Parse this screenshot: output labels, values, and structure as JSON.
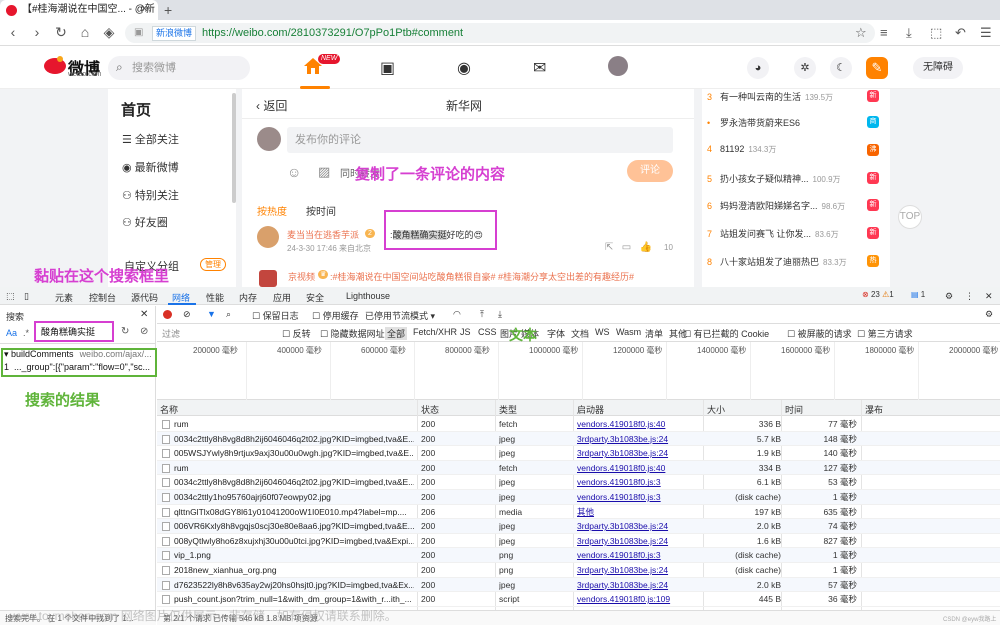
{
  "browser": {
    "tab_title": "【#桂海潮说在中国空... - @新",
    "new_tab": "+",
    "secure_label": "新浪微博",
    "url": "https://weibo.com/2810373291/O7pPo1Ptb#comment"
  },
  "weibo": {
    "logo_text": "微博",
    "logo_sub": "weibo.com",
    "search_placeholder": "搜索微博",
    "new_badge": "NEW",
    "access_button": "无障碍",
    "nav": {
      "home": "首页",
      "items": [
        "全部关注",
        "最新微博",
        "特别关注",
        "好友圈"
      ],
      "custom_group": "自定义分组",
      "manage": "管理"
    },
    "center": {
      "back": "返回",
      "title": "新华网",
      "comment_placeholder": "发布你的评论",
      "also_repost": "同时转发",
      "comment_button": "评论",
      "sort_hot": "按热度",
      "sort_time": "按时间",
      "comment": {
        "user": "麦当当在逃香芋派",
        "vip": "2",
        "text_highlight": "酸角糕确实挺",
        "text_rest": "好吃的😍",
        "meta": "24-3-30 17:46 来自北京",
        "likes": "10"
      },
      "repost_user": "京视频",
      "repost_text": ":#桂海潮说在中国空间站吃酸角糕很自豪# #桂海潮分享太空出差的有趣经历#"
    },
    "trending": [
      {
        "rank": "3",
        "title": "有一种叫云南的生活",
        "heat": "139.5万",
        "tag": "新",
        "color": "#ff3852"
      },
      {
        "rank": "•",
        "title": "罗永浩带货蔚来ES6",
        "heat": "",
        "tag": "商",
        "color": "#00b7ee"
      },
      {
        "rank": "4",
        "title": "81192",
        "heat": "134.3万",
        "tag": "沸",
        "color": "#f86400"
      },
      {
        "rank": "5",
        "title": "扔小孩女子疑似精神...",
        "heat": "100.9万",
        "tag": "新",
        "color": "#ff3852"
      },
      {
        "rank": "6",
        "title": "妈妈澄清欧阳娣娣名字...",
        "heat": "98.6万",
        "tag": "新",
        "color": "#ff3852"
      },
      {
        "rank": "7",
        "title": "站姐发问赛飞 让你发...",
        "heat": "83.6万",
        "tag": "新",
        "color": "#ff3852"
      },
      {
        "rank": "8",
        "title": "八十家站姐发了迪丽热巴",
        "heat": "83.3万",
        "tag": "热",
        "color": "#ff9406"
      }
    ],
    "totop": "TOP"
  },
  "annotations": {
    "copied": "复制了一条评论的内容",
    "paste_here": "黏贴在这个搜索框里",
    "text_label": "文本",
    "search_result": "搜索的结果"
  },
  "devtools": {
    "tabs": [
      "元素",
      "控制台",
      "源代码",
      "网络",
      "性能",
      "内存",
      "应用",
      "安全",
      "Lighthouse"
    ],
    "errors": "23",
    "warnings": "1",
    "messages": "1",
    "search_title": "搜索",
    "search_case": "Aa",
    "search_regex": ".*",
    "search_value": "酸角糕确实挺",
    "result_file": "buildComments",
    "result_url": "weibo.com/ajax/...",
    "result_line_no": "1",
    "result_line": "..._group\":[{\"param\":\"flow=0\",\"sc...",
    "search_status": "搜索完毕。 在 1 个文件中找到了 1...",
    "toolbar": {
      "preserve_log": "保留日志",
      "disable_cache": "停用缓存",
      "throttle": "已停用节流模式"
    },
    "filter": {
      "placeholder": "过滤",
      "invert": "反转",
      "hide_data": "隐藏数据网址",
      "types": [
        "全部",
        "Fetch/XHR",
        "JS",
        "CSS",
        "图片",
        "媒体",
        "字体",
        "文档",
        "WS",
        "Wasm",
        "清单",
        "其他"
      ],
      "blocked_cookies": "有已拦截的 Cookie",
      "blocked_requests": "被屏蔽的请求",
      "third_party": "第三方请求"
    },
    "timeline_ticks": [
      "200000 毫秒",
      "400000 毫秒",
      "600000 毫秒",
      "800000 毫秒",
      "1000000 毫秒",
      "1200000 毫秒",
      "1400000 毫秒",
      "1600000 毫秒",
      "1800000 毫秒",
      "2000000 毫秒"
    ],
    "columns": [
      "名称",
      "状态",
      "类型",
      "启动器",
      "大小",
      "时间",
      "瀑布"
    ],
    "rows": [
      {
        "name": "rum",
        "status": "200",
        "type": "fetch",
        "initiator": "vendors.419018f0.js:40",
        "size": "336 B",
        "time": "77 毫秒"
      },
      {
        "name": "0034c2ttly8h8vg8d8h2ij6046046q2t02.jpg?KID=imgbed,tva&E...",
        "status": "200",
        "type": "jpeg",
        "initiator": "3rdparty.3b1083be.js:24",
        "size": "5.7 kB",
        "time": "148 毫秒"
      },
      {
        "name": "005WSJYwly8h9rtjux9axj30u00u0wgh.jpg?KID=imgbed,tva&E...",
        "status": "200",
        "type": "jpeg",
        "initiator": "3rdparty.3b1083be.js:24",
        "size": "1.9 kB",
        "time": "140 毫秒"
      },
      {
        "name": "rum",
        "status": "200",
        "type": "fetch",
        "initiator": "vendors.419018f0.js:40",
        "size": "334 B",
        "time": "127 毫秒"
      },
      {
        "name": "0034c2ttly8h8vg8d8h2ij6046046q2t02.jpg?KID=imgbed,tva&E...",
        "status": "200",
        "type": "jpeg",
        "initiator": "vendors.419018f0.js:3",
        "size": "6.1 kB",
        "time": "53 毫秒"
      },
      {
        "name": "0034c2ttly1ho95760ajrj60f07eowpy02.jpg",
        "status": "200",
        "type": "jpeg",
        "initiator": "vendors.419018f0.js:3",
        "size": "(disk cache)",
        "time": "1 毫秒"
      },
      {
        "name": "qlttnGlTlx08dGY8l61y01041200oW1I0E010.mp4?label=mp....",
        "status": "206",
        "type": "media",
        "initiator": "其他",
        "size": "197 kB",
        "time": "635 毫秒"
      },
      {
        "name": "006VR6Kxly8h8vgqjs0scj30e80e8aa6.jpg?KID=imgbed,tva&E...",
        "status": "200",
        "type": "jpeg",
        "initiator": "3rdparty.3b1083be.js:24",
        "size": "2.0 kB",
        "time": "74 毫秒"
      },
      {
        "name": "008yQtlwly8ho6z8xujxhj30u00u0tci.jpg?KID=imgbed,tva&Expi...",
        "status": "200",
        "type": "jpeg",
        "initiator": "3rdparty.3b1083be.js:24",
        "size": "1.6 kB",
        "time": "827 毫秒"
      },
      {
        "name": "vip_1.png",
        "status": "200",
        "type": "png",
        "initiator": "vendors.419018f0.js:3",
        "size": "(disk cache)",
        "time": "1 毫秒"
      },
      {
        "name": "2018new_xianhua_org.png",
        "status": "200",
        "type": "png",
        "initiator": "3rdparty.3b1083be.js:24",
        "size": "(disk cache)",
        "time": "1 毫秒"
      },
      {
        "name": "d7623522ly8h8v635ay2wj20hs0hsjt0.jpg?KID=imgbed,tva&Ex...",
        "status": "200",
        "type": "jpeg",
        "initiator": "3rdparty.3b1083be.js:24",
        "size": "2.0 kB",
        "time": "57 毫秒"
      },
      {
        "name": "push_count.json?trim_null=1&with_dm_group=1&with_r...ith_...",
        "status": "200",
        "type": "script",
        "initiator": "vendors.419018f0.js:109",
        "size": "445 B",
        "time": "36 毫秒"
      }
    ],
    "status_bar": "第 2/1 个请求 已传输 546 kB  1.8 MB 项资源",
    "watermark": "www.toymoban.com 网络图片仅供展示，非存储，如有侵权请联系删除。",
    "csdn": "CSDN @eyw我路上"
  }
}
